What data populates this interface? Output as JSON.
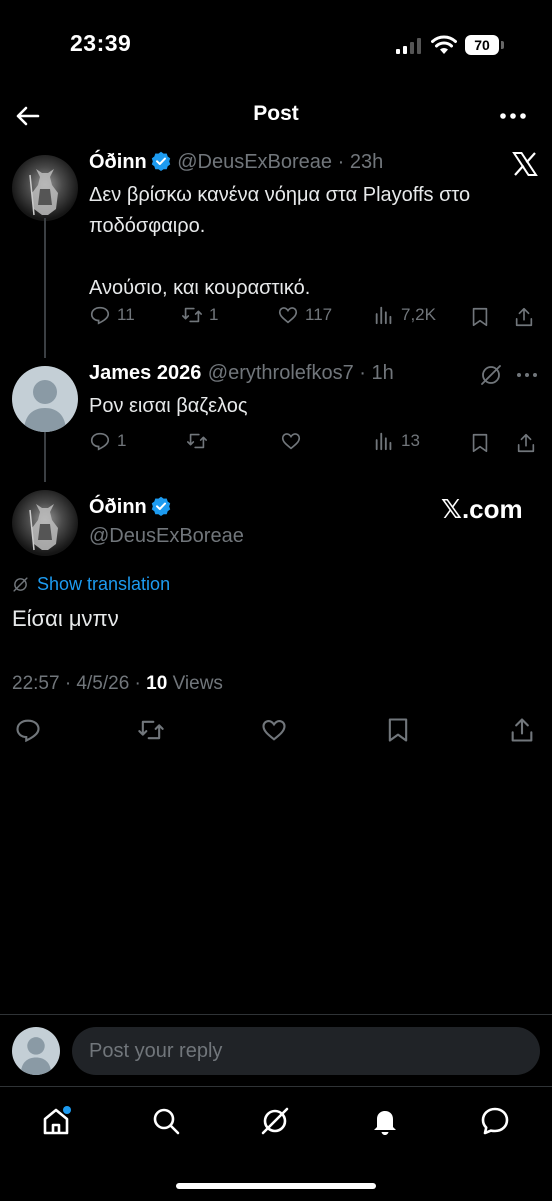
{
  "status_bar": {
    "time": "23:39",
    "battery": "70"
  },
  "header": {
    "title": "Post"
  },
  "post1": {
    "name": "Óðinn",
    "handle_time": "@DeusExBoreae · 23h",
    "text": "Δεν βρίσκω κανένα νόημα στα Playoffs στο ποδόσφαιρο.\n\nΑνούσιο, και κουραστικό.",
    "stats": {
      "replies": "11",
      "reposts": "1",
      "likes": "117",
      "views": "7,2K"
    }
  },
  "post2": {
    "name": "James 2026",
    "handle_time": "@erythrolefkos7 · 1h",
    "text": "Ρον εισαι βαζελος",
    "stats": {
      "replies": "1",
      "views": "13"
    }
  },
  "main_post": {
    "name": "Óðinn",
    "handle": "@DeusExBoreae",
    "watermark": "𝕏.com",
    "show_translation": "Show translation",
    "text": "Είσαι μνπν",
    "timestamp": "22:57 · 4/5/26 · ",
    "views_count": "10",
    "views_label": " Views"
  },
  "reply": {
    "placeholder": "Post your reply"
  },
  "tabbar": {
    "items": [
      "home-icon",
      "search-icon",
      "grok-icon",
      "notifications-icon",
      "messages-icon"
    ]
  },
  "colors": {
    "accent": "#1d9bf0",
    "muted": "#71767b",
    "background": "#000000"
  }
}
